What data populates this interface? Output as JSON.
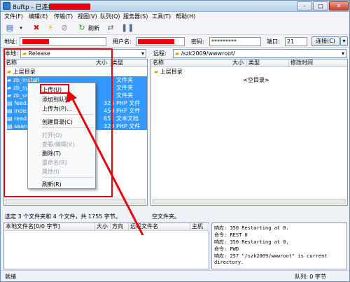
{
  "title": {
    "text": "8uftp - 已连接到"
  },
  "window_controls": {
    "minimize": "–",
    "maximize": "□",
    "close": "✕"
  },
  "menu": [
    "文件(F)",
    "编辑(E)",
    "传输(T)",
    "视图(V)",
    "队列(Q)",
    "服务器(S)",
    "工具(T)",
    "帮助(H)"
  ],
  "toolbar": {
    "refresh_label": "刷新"
  },
  "address": {
    "addr_label": "地址:",
    "user_label": "用户名:",
    "pass_label": "密码:",
    "password": "*********",
    "port_label": "端口:",
    "port": "21",
    "connect_label": "连接(C)"
  },
  "local": {
    "path_label": "本地:",
    "path": "Release",
    "columns": {
      "name": "名称",
      "size": "大小",
      "type": "类型"
    },
    "up_dir": "上层目录",
    "rows": [
      {
        "name": "zb_install",
        "size": "",
        "type": "文件夹"
      },
      {
        "name": "zb_sy",
        "size": "",
        "type": "文件夹"
      },
      {
        "name": "zb_us",
        "size": "",
        "type": "文件夹"
      },
      {
        "name": "feed.",
        "size": "325",
        "type": "PHP 文件"
      },
      {
        "name": "index",
        "size": "450",
        "type": "PHP 文件"
      },
      {
        "name": "readr",
        "size": "651",
        "type": "文本文档"
      },
      {
        "name": "searc",
        "size": "329",
        "type": "PHP 文件"
      }
    ],
    "status": "选定 3 个文件夹和 4 个文件，共 1755 字节。"
  },
  "remote": {
    "path_label": "远程:",
    "path": "/szk2009/wwwroot/",
    "columns": {
      "name": "名称",
      "size": "大小",
      "type": "类型",
      "mtime": "修改时间"
    },
    "up_dir": "上层目录",
    "empty": "<空目录>",
    "status": "空文件夹。"
  },
  "context_menu": [
    {
      "label": "上传(U)",
      "enabled": true
    },
    {
      "label": "添加到队列",
      "enabled": true
    },
    {
      "label": "上传为(P)...",
      "enabled": true
    },
    {
      "label": "创建目录(C)",
      "enabled": true
    },
    {
      "label": "打开(O)",
      "enabled": false
    },
    {
      "label": "查看/编辑(V)",
      "enabled": false
    },
    {
      "label": "删除(T)",
      "enabled": true
    },
    {
      "label": "重命名(R)",
      "enabled": false
    },
    {
      "label": "属性(I)",
      "enabled": false
    },
    {
      "label": "刷新(R)",
      "enabled": true
    }
  ],
  "queue": {
    "columns": {
      "local": "本地文件名[0/0 字节]",
      "size": "大小",
      "dir": "方向",
      "remote": "远程文件名",
      "host": "主机"
    }
  },
  "log": [
    {
      "label": "响应:",
      "text": "350 Restarting at 0."
    },
    {
      "label": "命令:",
      "text": "REST 0"
    },
    {
      "label": "响应:",
      "text": "350 Restarting at 0."
    },
    {
      "label": "命令:",
      "text": "PWD"
    },
    {
      "label": "响应:",
      "text": "257 \"/szk2009/wwwroot\" is current"
    },
    {
      "label": "",
      "text": "directory."
    }
  ],
  "statusbar": {
    "left": "就绪",
    "queue": "队列: 0 字节"
  },
  "colors": {
    "annotation_red": "#e8000b",
    "selection": "#3399ff"
  }
}
